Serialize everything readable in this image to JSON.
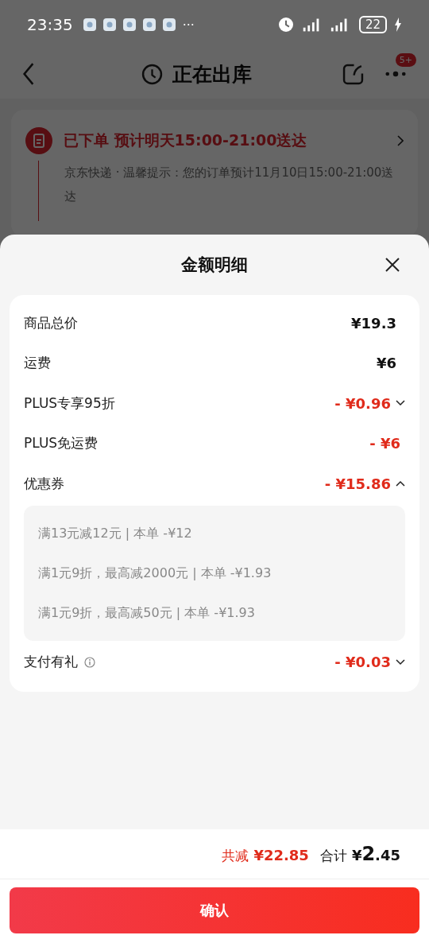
{
  "status_bar": {
    "time": "23:35",
    "more": "···",
    "battery": "22"
  },
  "header": {
    "title": "正在出库",
    "badge": "5+"
  },
  "order": {
    "status": "已下单 预计明天15:00-21:00送达",
    "note": "京东快递 · 温馨提示：您的订单预计11月10日15:00-21:00送达"
  },
  "sheet": {
    "title": "金额明细",
    "rows": [
      {
        "kind": "plain",
        "label": "商品总价",
        "amount": "¥19.3"
      },
      {
        "kind": "plain",
        "label": "运费",
        "amount": "¥6"
      },
      {
        "kind": "discount",
        "label": "PLUS专享95折",
        "amount": "- ¥0.96",
        "expanded": false
      },
      {
        "kind": "discount_fixed",
        "label": "PLUS免运费",
        "amount": "- ¥6"
      },
      {
        "kind": "discount",
        "label": "优惠券",
        "amount": "- ¥15.86",
        "expanded": true,
        "details": [
          "满13元减12元 | 本单 -¥12",
          "满1元9折，最高减2000元 | 本单 -¥1.93",
          "满1元9折，最高减50元 | 本单 -¥1.93"
        ]
      },
      {
        "kind": "discount",
        "label": "支付有礼",
        "amount": "- ¥0.03",
        "expanded": false,
        "info": true
      }
    ]
  },
  "footer": {
    "saved_label": "共减",
    "saved_amount": "¥22.85",
    "total_label": "合计",
    "total_amount": "¥2.45",
    "confirm": "确认"
  }
}
